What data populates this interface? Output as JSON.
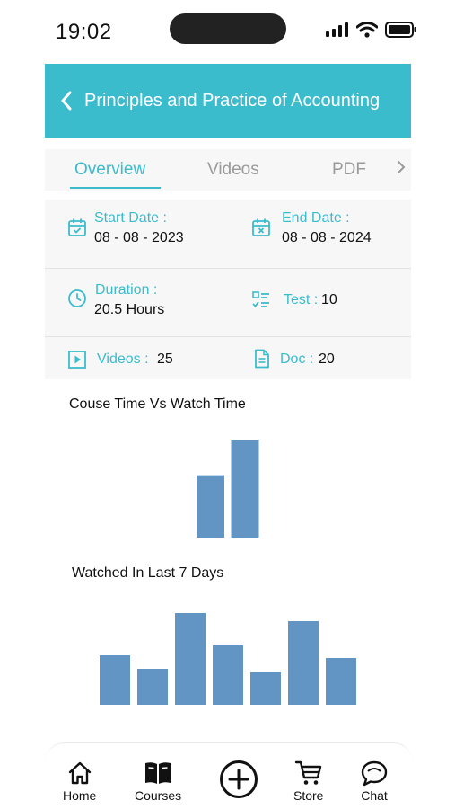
{
  "status_bar": {
    "time": "19:02"
  },
  "header": {
    "title": "Principles and Practice of Accounting"
  },
  "tabs": [
    {
      "label": "Overview",
      "active": true
    },
    {
      "label": "Videos",
      "active": false
    },
    {
      "label": "PDF",
      "active": false
    }
  ],
  "info": {
    "start_label": "Start Date :",
    "start_value": "08 - 08 - 2023",
    "end_label": "End Date :",
    "end_value": "08 - 08 - 2024",
    "duration_label": "Duration :",
    "duration_value": "20.5 Hours",
    "test_label": "Test :",
    "test_value": "10",
    "videos_label": "Videos :",
    "videos_value": "25",
    "doc_label": "Doc :",
    "doc_value": "20"
  },
  "colors": {
    "accent": "#3bbccd",
    "bar": "#6294c4"
  },
  "chart_data": [
    {
      "type": "bar",
      "title": "Couse Time Vs Watch Time",
      "categories": [
        "",
        ""
      ],
      "values": [
        70,
        110
      ],
      "ylim": [
        0,
        110
      ]
    },
    {
      "type": "bar",
      "title": "Watched In Last 7 Days",
      "categories": [
        "",
        "",
        "",
        "",
        "",
        "",
        ""
      ],
      "values": [
        55,
        40,
        102,
        66,
        36,
        93,
        52
      ],
      "ylim": [
        0,
        102
      ]
    }
  ],
  "bottom_nav": [
    {
      "label": "Home",
      "icon": "home-icon"
    },
    {
      "label": "Courses",
      "icon": "book-icon"
    },
    {
      "label": "",
      "icon": "plus-circle-icon"
    },
    {
      "label": "Store",
      "icon": "cart-icon"
    },
    {
      "label": "Chat",
      "icon": "chat-icon"
    }
  ]
}
